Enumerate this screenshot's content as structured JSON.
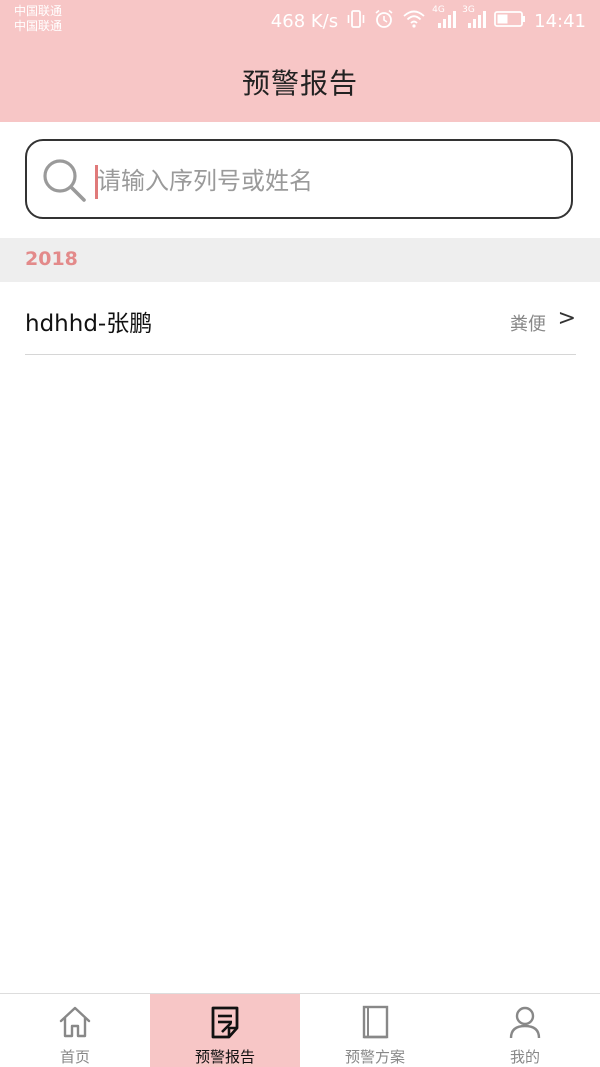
{
  "status_bar": {
    "carrier_1": "中国联通",
    "carrier_2": "中国联通",
    "speed": "468 K/s",
    "network_4g": "4G",
    "network_3g": "3G",
    "time": "14:41"
  },
  "header": {
    "title": "预警报告"
  },
  "search": {
    "placeholder": "请输入序列号或姓名",
    "value": ""
  },
  "section": {
    "year": "2018"
  },
  "list": {
    "items": [
      {
        "title": "hdhhd-张鹏",
        "tag": "粪便",
        "chevron": ">"
      }
    ]
  },
  "bottom_nav": {
    "items": [
      {
        "label": "首页",
        "icon": "home-icon",
        "active": false
      },
      {
        "label": "预警报告",
        "icon": "report-icon",
        "active": true
      },
      {
        "label": "预警方案",
        "icon": "book-icon",
        "active": false
      },
      {
        "label": "我的",
        "icon": "person-icon",
        "active": false
      }
    ]
  },
  "colors": {
    "header_bg": "#f7c6c6",
    "accent": "#e38a8a"
  }
}
